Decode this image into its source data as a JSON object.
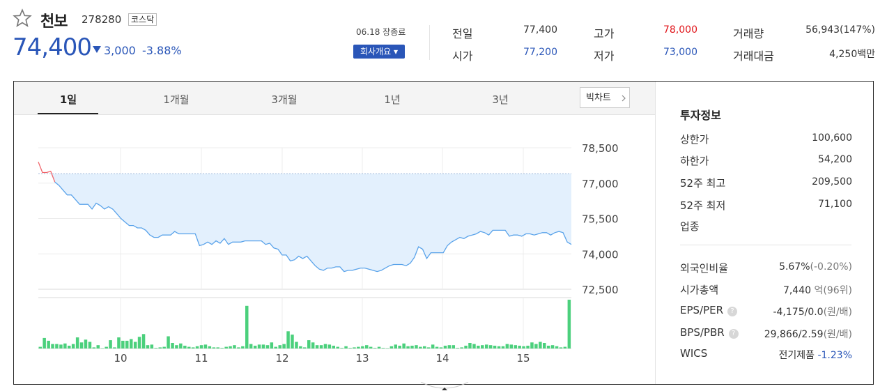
{
  "header": {
    "stock_name": "천보",
    "stock_code": "278280",
    "market": "코스닥",
    "price": "74,400",
    "change": "3,000",
    "change_pct": "-3.88%",
    "session": "06.18 장종료",
    "company_button": "회사개요 ▾",
    "stats": {
      "prev_close_label": "전일",
      "prev_close": "77,400",
      "open_label": "시가",
      "open": "77,200",
      "high_label": "고가",
      "high": "78,000",
      "low_label": "저가",
      "low": "73,000",
      "volume_label": "거래량",
      "volume": "56,943(147%)",
      "amount_label": "거래대금",
      "amount": "4,250백만"
    },
    "colors": {
      "up": "#e0161b",
      "down": "#2a56b8"
    }
  },
  "tabs": [
    "1일",
    "1개월",
    "3개월",
    "1년",
    "3년"
  ],
  "active_tab": "1일",
  "big_chart_button": "빅차트",
  "chart_data": {
    "type": "line",
    "ylim": [
      72500,
      78500
    ],
    "yticks": [
      "78,500",
      "77,000",
      "75,500",
      "74,000",
      "72,500"
    ],
    "xticks": [
      "10",
      "11",
      "12",
      "13",
      "14",
      "15"
    ],
    "prev_close_line": 77400,
    "price_series": [
      77900,
      77450,
      77450,
      77500,
      77050,
      76900,
      76700,
      76500,
      76500,
      76300,
      76100,
      76100,
      76100,
      75900,
      76150,
      76050,
      75900,
      76000,
      75900,
      75700,
      75500,
      75350,
      75200,
      75200,
      75100,
      75100,
      75000,
      74800,
      74700,
      74700,
      74800,
      74800,
      74800,
      74950,
      74850,
      74850,
      74850,
      74850,
      74850,
      74350,
      74400,
      74500,
      74400,
      74550,
      74450,
      74650,
      74400,
      74500,
      74500,
      74500,
      74550,
      74550,
      74550,
      74550,
      74550,
      74400,
      74450,
      74250,
      74200,
      73950,
      73950,
      73700,
      73750,
      73900,
      73800,
      73900,
      73700,
      73500,
      73350,
      73300,
      73400,
      73400,
      73450,
      73450,
      73250,
      73300,
      73300,
      73350,
      73400,
      73400,
      73350,
      73300,
      73250,
      73300,
      73400,
      73500,
      73550,
      73550,
      73550,
      73500,
      73600,
      73850,
      74300,
      74200,
      73800,
      74050,
      74050,
      74050,
      74050,
      74350,
      74500,
      74600,
      74700,
      74650,
      74750,
      74800,
      74850,
      74950,
      74900,
      74800,
      75000,
      75000,
      75000,
      75000,
      74750,
      74800,
      74800,
      74750,
      74850,
      74850,
      74800,
      74850,
      74900,
      74900,
      74800,
      74900,
      74950,
      74900,
      74500,
      74400
    ],
    "volume_series": [
      3,
      19,
      14,
      8,
      8,
      7,
      9,
      5,
      8,
      20,
      11,
      16,
      12,
      2,
      6,
      0,
      3,
      15,
      2,
      20,
      14,
      14,
      17,
      12,
      21,
      26,
      6,
      7,
      1,
      2,
      3,
      22,
      10,
      6,
      9,
      5,
      3,
      2,
      4,
      6,
      7,
      4,
      2,
      2,
      1,
      3,
      4,
      6,
      2,
      4,
      77,
      8,
      5,
      7,
      7,
      6,
      11,
      3,
      6,
      8,
      31,
      25,
      12,
      4,
      2,
      15,
      11,
      6,
      6,
      8,
      7,
      5,
      3,
      1,
      4,
      1,
      2,
      3,
      4,
      6,
      3,
      1,
      3,
      1,
      0,
      4,
      7,
      5,
      9,
      4,
      5,
      6,
      3,
      4,
      2,
      7,
      3,
      2,
      5,
      6,
      6,
      1,
      2,
      5,
      10,
      8,
      5,
      6,
      7,
      6,
      5,
      4,
      4,
      8,
      7,
      6,
      5,
      4,
      5,
      11,
      8,
      12,
      10,
      5,
      6,
      4,
      2,
      3,
      88
    ]
  },
  "invest_info": {
    "title": "투자정보",
    "items": [
      {
        "label": "상한가",
        "value": "100,600",
        "tone": "up"
      },
      {
        "label": "하한가",
        "value": "54,200",
        "tone": "down"
      },
      {
        "label": "52주 최고",
        "value": "209,500",
        "tone": ""
      },
      {
        "label": "52주 최저",
        "value": "71,100",
        "tone": ""
      },
      {
        "label": "업종",
        "value": "",
        "tone": ""
      }
    ],
    "foreign_label": "외국인비율",
    "foreign_value": "5.67%",
    "foreign_sub": "(-0.20%)",
    "mcap_label": "시가총액",
    "mcap_value": "7,440",
    "mcap_sub": "억(96위)",
    "eps_label": "EPS/PER",
    "eps_value": "-4,175/0.0",
    "eps_sub": "(원/배)",
    "bps_label": "BPS/PBR",
    "bps_value": "29,866/2.59",
    "bps_sub": "(원/배)",
    "wics_label": "WICS",
    "wics_value": "전기제품",
    "wics_pct": "-1.23%"
  }
}
